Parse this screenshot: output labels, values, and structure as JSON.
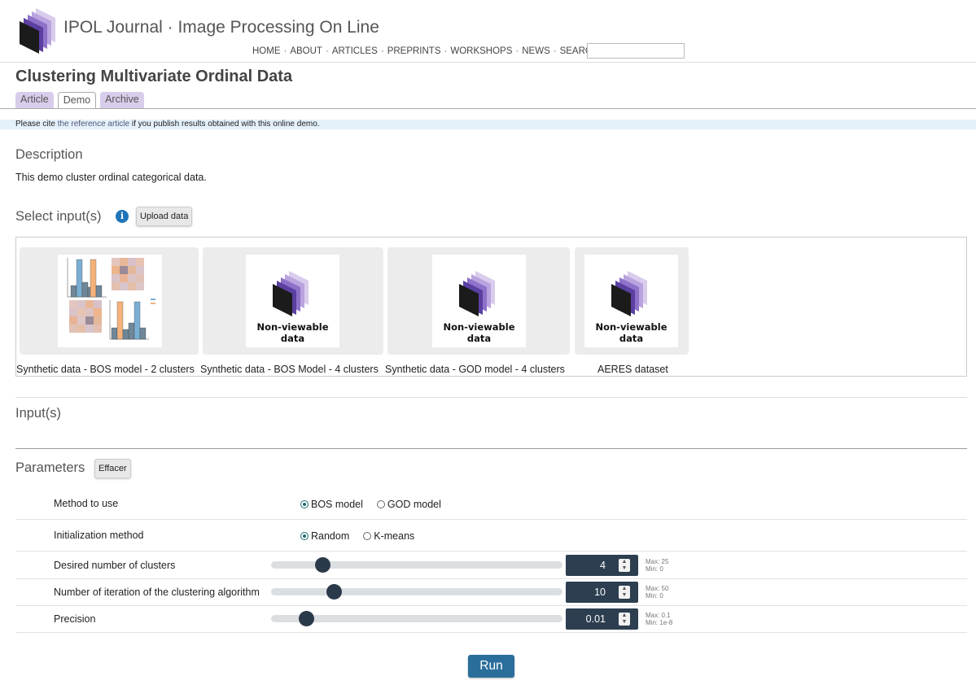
{
  "site": {
    "title": "IPOL Journal · Image Processing On Line"
  },
  "nav": {
    "items": [
      "HOME",
      "ABOUT",
      "ARTICLES",
      "PREPRINTS",
      "WORKSHOPS",
      "NEWS",
      "SEARCH"
    ],
    "search_value": ""
  },
  "page": {
    "title": "Clustering Multivariate Ordinal Data",
    "tabs": [
      {
        "label": "Article",
        "active": false
      },
      {
        "label": "Demo",
        "active": true
      },
      {
        "label": "Archive",
        "active": false
      }
    ]
  },
  "cite": {
    "before": "Please cite ",
    "link": "the reference article",
    "after": " if you publish results obtained with this online demo."
  },
  "description": {
    "heading": "Description",
    "text": "This demo cluster ordinal categorical data."
  },
  "inputs_select": {
    "heading": "Select input(s)",
    "info_icon": "i",
    "upload_label": "Upload data",
    "items": [
      {
        "label": "Synthetic data - BOS model - 2 clusters",
        "thumb": "histogram-preview"
      },
      {
        "label": "Synthetic data - BOS Model - 4 clusters",
        "thumb": "non-viewable",
        "thumb_text": "Non-viewable data"
      },
      {
        "label": "Synthetic data - GOD model - 4 clusters",
        "thumb": "non-viewable",
        "thumb_text": "Non-viewable data"
      },
      {
        "label": "AERES dataset",
        "thumb": "non-viewable",
        "thumb_text": "Non-viewable data"
      }
    ]
  },
  "inputs": {
    "heading": "Input(s)"
  },
  "parameters": {
    "heading": "Parameters",
    "reset_label": "Effacer",
    "method": {
      "label": "Method to use",
      "options": [
        {
          "label": "BOS model",
          "checked": true
        },
        {
          "label": "GOD model",
          "checked": false
        }
      ]
    },
    "init": {
      "label": "Initialization method",
      "options": [
        {
          "label": "Random",
          "checked": true
        },
        {
          "label": "K-means",
          "checked": false
        }
      ]
    },
    "clusters": {
      "label": "Desired number of clusters",
      "value": "4",
      "max": "Max: 25",
      "min": "Min: 0",
      "level": 0.16
    },
    "iterations": {
      "label": "Number of iteration of the clustering algorithm",
      "value": "10",
      "max": "Max: 50",
      "min": "Min: 0",
      "level": 0.2
    },
    "precision": {
      "label": "Precision",
      "value": "0.01",
      "max": "Max: 0.1",
      "min": "Min: 1e-8",
      "level": 0.1
    }
  },
  "run_label": "Run",
  "colors": {
    "accent": "#2a6e9c",
    "tab_bg": "#d8cdea",
    "num_box": "#2c3e50",
    "cite_bg": "#e4f1fa"
  }
}
